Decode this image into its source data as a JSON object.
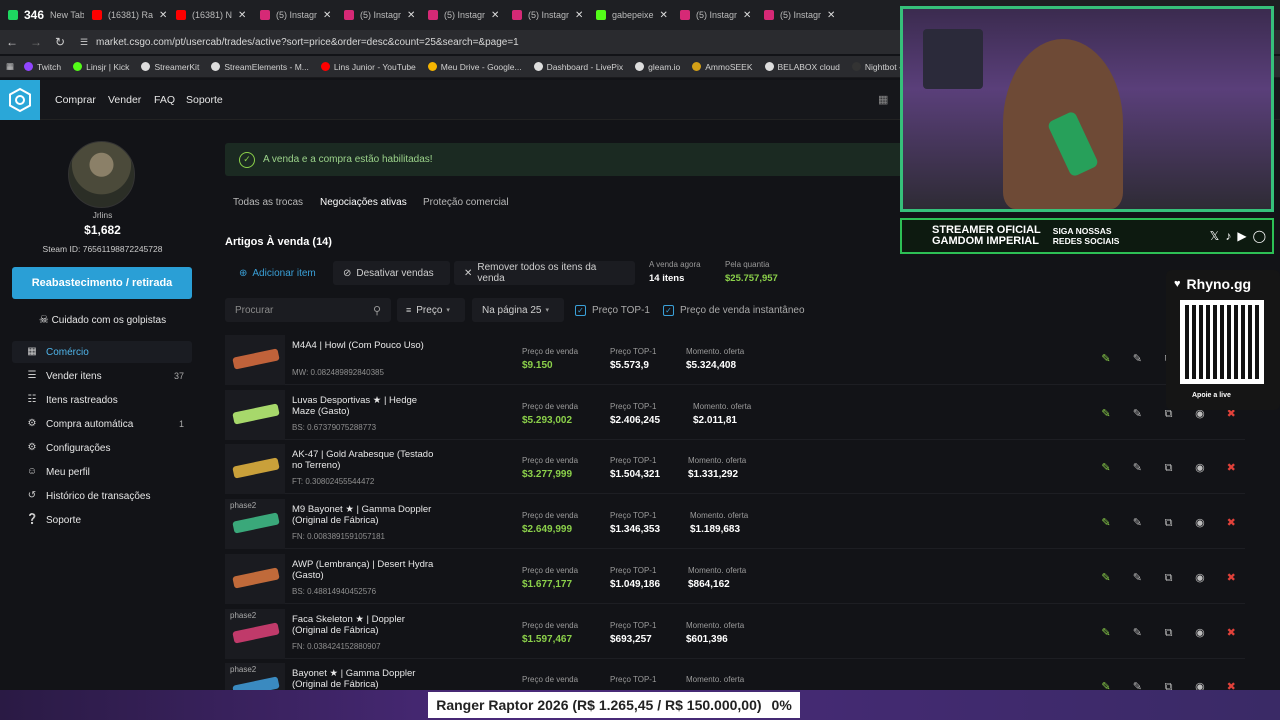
{
  "browser": {
    "tabs": [
      {
        "label": "346",
        "title": "New Tab",
        "color": "#1ed760"
      },
      {
        "label": "(16381) Ra",
        "color": "#ff0000"
      },
      {
        "label": "(16381) N",
        "color": "#ff0000"
      },
      {
        "label": "(5) Instagr",
        "color": "#d62976"
      },
      {
        "label": "(5) Instagr",
        "color": "#d62976"
      },
      {
        "label": "(5) Instagr",
        "color": "#d62976"
      },
      {
        "label": "(5) Instagr",
        "color": "#d62976"
      },
      {
        "label": "gabepeixe",
        "color": "#53fc18"
      },
      {
        "label": "(5) Instagr",
        "color": "#d62976"
      },
      {
        "label": "(5) Instagr",
        "color": "#d62976"
      }
    ],
    "url": "market.csgo.com/pt/usercab/trades/active?sort=price&order=desc&count=25&search=&page=1",
    "bookmarks": [
      {
        "label": "Twitch",
        "color": "#9146ff"
      },
      {
        "label": "Linsjr | Kick",
        "color": "#53fc18"
      },
      {
        "label": "StreamerKit",
        "color": "#dddddd"
      },
      {
        "label": "StreamElements - M...",
        "color": "#dddddd"
      },
      {
        "label": "Lins Junior - YouTube",
        "color": "#ff0000"
      },
      {
        "label": "Meu Drive - Google...",
        "color": "#f4b400"
      },
      {
        "label": "Dashboard - LivePix",
        "color": "#dddddd"
      },
      {
        "label": "gleam.io",
        "color": "#dddddd"
      },
      {
        "label": "AmmoSEEK",
        "color": "#d4a017"
      },
      {
        "label": "BELABOX cloud",
        "color": "#dddddd"
      },
      {
        "label": "Nightbot - Comm",
        "color": "#333333"
      }
    ]
  },
  "header": {
    "nav": [
      "Comprar",
      "Vender",
      "FAQ",
      "Soporte"
    ]
  },
  "profile": {
    "username": "Jrlins",
    "balance": "$1,682",
    "steam_id_label": "Steam ID:",
    "steam_id": "76561198872245728",
    "refill_button": "Reabastecimento / retirada",
    "warning": "Cuidado com os golpistas"
  },
  "sidebar_menu": [
    {
      "label": "Comércio",
      "icon": "grid-icon",
      "count": ""
    },
    {
      "label": "Vender itens",
      "icon": "list-icon",
      "count": "37"
    },
    {
      "label": "Itens rastreados",
      "icon": "tracking-icon",
      "count": ""
    },
    {
      "label": "Compra automática",
      "icon": "auto-buy-icon",
      "count": "1"
    },
    {
      "label": "Configurações",
      "icon": "gear-icon",
      "count": ""
    },
    {
      "label": "Meu perfil",
      "icon": "user-icon",
      "count": ""
    },
    {
      "label": "Histórico de transações",
      "icon": "history-icon",
      "count": ""
    },
    {
      "label": "Soporte",
      "icon": "support-icon",
      "count": ""
    }
  ],
  "alert": {
    "text": "A venda e a compra estão habilitadas!"
  },
  "subtabs": [
    "Todas as trocas",
    "Negociações ativas",
    "Proteção comercial"
  ],
  "section": {
    "title": "Artigos À venda (14)",
    "add_item": "Adicionar item",
    "disable_sales": "Desativar vendas",
    "remove_all": "Remover todos os itens da venda",
    "on_sale_label": "A venda agora",
    "on_sale_value": "14 itens",
    "quantity_label": "Pela quantia",
    "quantity_value": "$25.757,957"
  },
  "filters": {
    "search_placeholder": "Procurar",
    "price": "Preço",
    "per_page": "Na página 25",
    "top1": "Preço TOP-1",
    "instant": "Preço de venda instantâneo"
  },
  "labels": {
    "sell": "Preço de venda",
    "top1": "Preço TOP-1",
    "offer": "Momento. oferta"
  },
  "items": [
    {
      "name": "M4A4 | Howl (Com Pouco Uso)",
      "float": "MW: 0.082489892840385",
      "sell": "$9.150",
      "top1": "$5.573,9",
      "offer": "$5.324,408",
      "tag": "",
      "color": "#c0623a"
    },
    {
      "name": "Luvas Desportivas ★ | Hedge Maze (Gasto)",
      "float": "BS: 0.67379075288773",
      "sell": "$5.293,002",
      "top1": "$2.406,245",
      "offer": "$2.011,81",
      "tag": "",
      "color": "#a7d86b"
    },
    {
      "name": "AK-47 | Gold Arabesque (Testado no Terreno)",
      "float": "FT: 0.30802455544472",
      "sell": "$3.277,999",
      "top1": "$1.504,321",
      "offer": "$1.331,292",
      "tag": "",
      "color": "#c9a03a"
    },
    {
      "name": "M9 Bayonet ★ | Gamma Doppler (Original de Fábrica)",
      "float": "FN: 0.0083891591057181",
      "sell": "$2.649,999",
      "top1": "$1.346,353",
      "offer": "$1.189,683",
      "tag": "phase2",
      "color": "#3aa87a"
    },
    {
      "name": "AWP (Lembrança) | Desert Hydra (Gasto)",
      "float": "BS: 0.48814940452576",
      "sell": "$1.677,177",
      "top1": "$1.049,186",
      "offer": "$864,162",
      "tag": "",
      "color": "#c06a3a"
    },
    {
      "name": "Faca Skeleton ★ | Doppler (Original de Fábrica)",
      "float": "FN: 0.038424152880907",
      "sell": "$1.597,467",
      "top1": "$693,257",
      "offer": "$601,396",
      "tag": "phase2",
      "color": "#c03a6a"
    },
    {
      "name": "Bayonet ★ | Gamma Doppler (Original de Fábrica)",
      "float": "",
      "sell": "",
      "top1": "",
      "offer": "",
      "tag": "phase2",
      "color": "#3a8ac0"
    }
  ],
  "overlays": {
    "banner_line1": "STREAMER OFICIAL",
    "banner_line2": "GAMDOM IMPERIAL",
    "banner_social1": "SIGA NOSSAS",
    "banner_social2": "REDES SOCIAIS",
    "rhyno": "Rhyno.gg",
    "rhyno_cta": "Apoie a live",
    "ticker": "Ranger Raptor 2026 (R$ 1.265,45 / R$ 150.000,00)",
    "ticker_pct": "0%"
  },
  "colors": {
    "accent": "#2a9fd6",
    "green": "#8bd04a",
    "alert_green": "#9bd38a",
    "delete": "#e0413a"
  }
}
